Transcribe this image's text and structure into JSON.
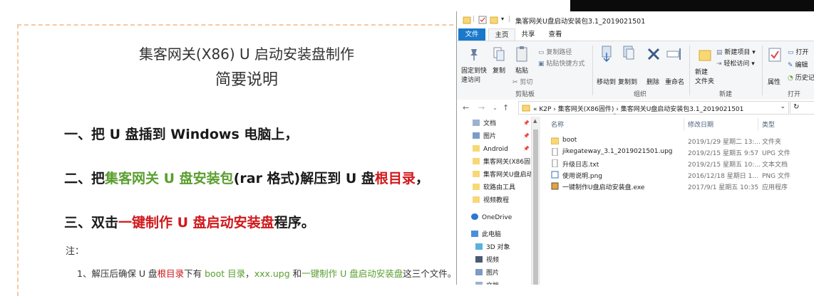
{
  "document": {
    "title": "集客网关(X86) U 启动安装盘制作",
    "subtitle": "简要说明",
    "step1": "一、把 U 盘插到 Windows 电脑上，",
    "step2": {
      "a": "二、把",
      "b": "集客网关 U 盘安装包",
      "c": "(rar 格式)解压到 U 盘",
      "d": "根目录",
      "e": "，"
    },
    "step3": {
      "a": "三、双击",
      "b": "一键制作 U 盘启动安装盘",
      "c": "程序。"
    },
    "note_label": "注：",
    "note1": {
      "a": "1、解压后确保 U 盘",
      "b": "根目录",
      "c": "下有 ",
      "d": "boot 目录",
      "e": "，",
      "f": "xxx.upg",
      "g": " 和",
      "h": "一键制作 U 盘启动安装盘",
      "i": "这三个文件。"
    }
  },
  "explorer": {
    "window_title": "集客网关U盘启动安装包3.1_2019021501",
    "tabs": {
      "file": "文件",
      "home": "主页",
      "share": "共享",
      "view": "查看"
    },
    "ribbon": {
      "pin_quick": "固定到快",
      "pin_quick2": "速访问",
      "copy": "复制",
      "paste": "粘贴",
      "copy_path": "复制路径",
      "paste_shortcut": "粘贴快捷方式",
      "cut": "剪切",
      "clipboard_group": "剪贴板",
      "move_to": "移动到",
      "copy_to": "复制到",
      "delete": "删除",
      "rename": "重命名",
      "organize_group": "组织",
      "new_folder": "新建",
      "new_folder2": "文件夹",
      "new_item": "新建项目 ▾",
      "easy_access": "轻松访问 ▾",
      "new_group": "新建",
      "properties": "属性",
      "open": "打开",
      "edit": "编辑",
      "history": "历史记",
      "open_group": "打开"
    },
    "address": {
      "crumbs": "«  K2P  ›  集客网关(X86固件)  ›  集客网关U盘启动安装包3.1_2019021501"
    },
    "nav_items": [
      {
        "label": "文档",
        "pinned": true
      },
      {
        "label": "图片",
        "pinned": true
      },
      {
        "label": "Android",
        "pinned": true
      },
      {
        "label": "集客网关(X86固",
        "pinned": false
      },
      {
        "label": "集客网关U盘启动",
        "pinned": false
      },
      {
        "label": "软路由工具",
        "pinned": false
      },
      {
        "label": "视频教程",
        "pinned": false
      },
      {
        "label": "OneDrive",
        "pinned": false
      },
      {
        "label": "此电脑",
        "pinned": false
      },
      {
        "label": "3D 对象",
        "pinned": false
      },
      {
        "label": "视频",
        "pinned": false
      },
      {
        "label": "图片",
        "pinned": false
      },
      {
        "label": "文档",
        "pinned": false
      }
    ],
    "columns": {
      "name": "名称",
      "date": "修改日期",
      "type": "类型"
    },
    "files": [
      {
        "name": "boot",
        "date": "2019/1/29 星期二 13:...",
        "type": "文件夹",
        "icon": "folder-icon"
      },
      {
        "name": "jikegateway_3.1_2019021501.upg",
        "date": "2019/2/15 星期五 9:57",
        "type": "UPG 文件",
        "icon": "file-icon"
      },
      {
        "name": "升级日志.txt",
        "date": "2019/2/15 星期五 10:...",
        "type": "文本文档",
        "icon": "text-file-icon"
      },
      {
        "name": "使用说明.png",
        "date": "2016/12/18 星期日 1...",
        "type": "PNG 文件",
        "icon": "image-file-icon"
      },
      {
        "name": "一键制作U盘启动安装盘.exe",
        "date": "2017/9/1 星期五 10:35",
        "type": "应用程序",
        "icon": "exe-icon"
      }
    ],
    "colors": {
      "file_tab": "#1979ca",
      "folder": "#f8d775",
      "green": "#5a9e2f",
      "red": "#d0181b"
    }
  }
}
